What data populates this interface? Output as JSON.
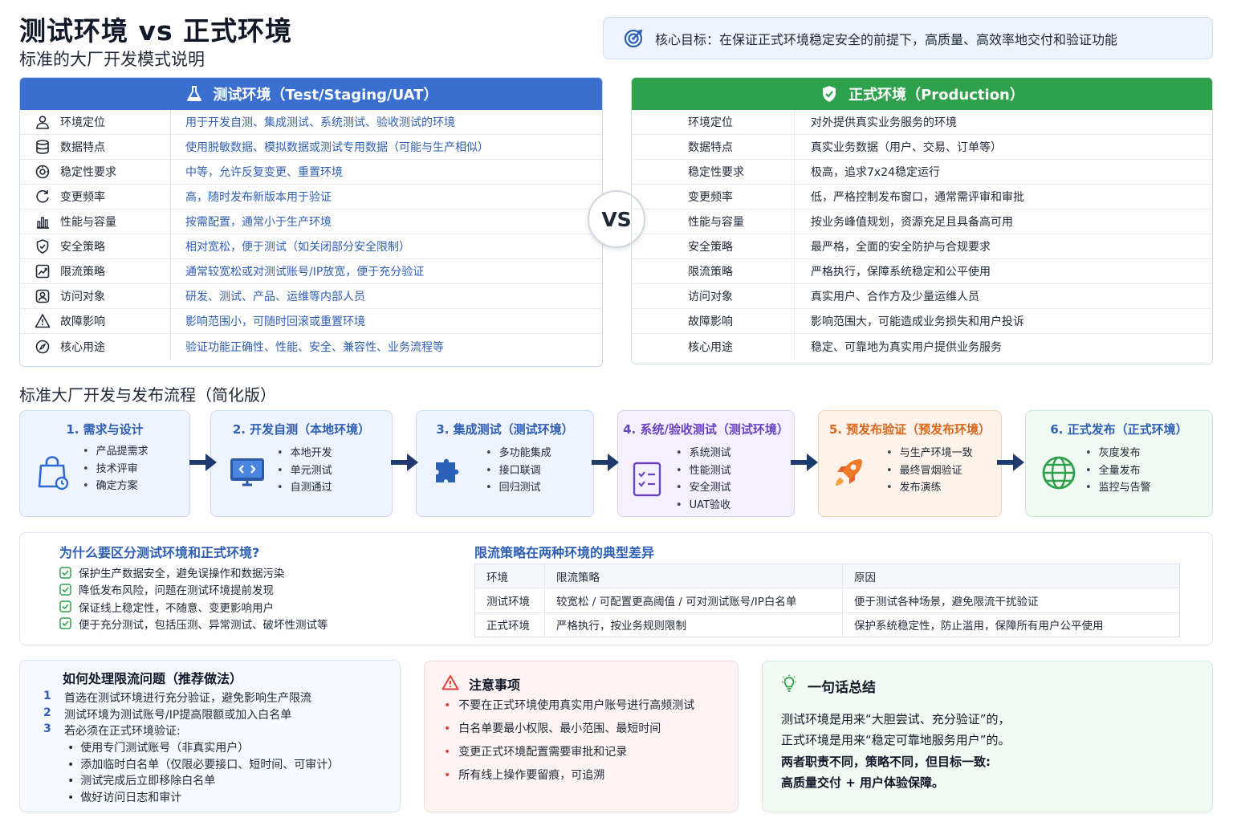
{
  "header": {
    "title": "测试环境 vs 正式环境",
    "subtitle": "标准的大厂开发模式说明",
    "goal": "核心目标：在保证正式环境稳定安全的前提下，高质量、高效率地交付和验证功能"
  },
  "test_env": {
    "title": "测试环境（Test/Staging/UAT）",
    "accent": "#3a6fd0",
    "rows": [
      {
        "label": "环境定位",
        "value": "用于开发自测、集成测试、系统测试、验收测试的环境"
      },
      {
        "label": "数据特点",
        "value": "使用脱敏数据、模拟数据或测试专用数据（可能与生产相似）"
      },
      {
        "label": "稳定性要求",
        "value": "中等，允许反复变更、重置环境"
      },
      {
        "label": "变更频率",
        "value": "高，随时发布新版本用于验证"
      },
      {
        "label": "性能与容量",
        "value": "按需配置，通常小于生产环境"
      },
      {
        "label": "安全策略",
        "value": "相对宽松，便于测试（如关闭部分安全限制）"
      },
      {
        "label": "限流策略",
        "value": "通常较宽松或对测试账号/IP放宽，便于充分验证"
      },
      {
        "label": "访问对象",
        "value": "研发、测试、产品、运维等内部人员"
      },
      {
        "label": "故障影响",
        "value": "影响范围小，可随时回滚或重置环境"
      },
      {
        "label": "核心用途",
        "value": "验证功能正确性、性能、安全、兼容性、业务流程等"
      }
    ]
  },
  "vs_label": "VS",
  "prod_env": {
    "title": "正式环境（Production）",
    "accent": "#2fa04b",
    "rows": [
      {
        "label": "环境定位",
        "value": "对外提供真实业务服务的环境"
      },
      {
        "label": "数据特点",
        "value": "真实业务数据（用户、交易、订单等）"
      },
      {
        "label": "稳定性要求",
        "value": "极高，追求7x24稳定运行"
      },
      {
        "label": "变更频率",
        "value": "低，严格控制发布窗口，通常需评审和审批"
      },
      {
        "label": "性能与容量",
        "value": "按业务峰值规划，资源充足且具备高可用"
      },
      {
        "label": "安全策略",
        "value": "最严格，全面的安全防护与合规要求"
      },
      {
        "label": "限流策略",
        "value": "严格执行，保障系统稳定和公平使用"
      },
      {
        "label": "访问对象",
        "value": "真实用户、合作方及少量运维人员"
      },
      {
        "label": "故障影响",
        "value": "影响范围大，可能造成业务损失和用户投诉"
      },
      {
        "label": "核心用途",
        "value": "稳定、可靠地为真实用户提供业务服务"
      }
    ]
  },
  "flow": {
    "title": "标准大厂开发与发布流程（简化版）",
    "steps": [
      {
        "title": "1. 需求与设计",
        "items": [
          "产品提需求",
          "技术评审",
          "确定方案"
        ],
        "color": "#2f5fb3"
      },
      {
        "title": "2. 开发自测（本地环境）",
        "items": [
          "本地开发",
          "单元测试",
          "自测通过"
        ],
        "color": "#2f5fb3"
      },
      {
        "title": "3. 集成测试（测试环境）",
        "items": [
          "多功能集成",
          "接口联调",
          "回归测试"
        ],
        "color": "#2f5fb3"
      },
      {
        "title": "4. 系统/验收测试（测试环境）",
        "items": [
          "系统测试",
          "性能测试",
          "安全测试",
          "UAT验收"
        ],
        "color": "#6a43c2"
      },
      {
        "title": "5. 预发布验证（预发布环境）",
        "items": [
          "与生产环境一致",
          "最终冒烟验证",
          "发布演练"
        ],
        "color": "#d9661a"
      },
      {
        "title": "6. 正式发布（正式环境）",
        "items": [
          "灰度发布",
          "全量发布",
          "监控与告警"
        ],
        "color": "#2f5fb3"
      }
    ]
  },
  "why": {
    "title": "为什么要区分测试环境和正式环境?",
    "items": [
      "保护生产数据安全，避免误操作和数据污染",
      "降低发布风险，问题在测试环境提前发现",
      "保证线上稳定性，不随意、变更影响用户",
      "便于充分测试，包括压测、异常测试、破坏性测试等"
    ]
  },
  "limit_table": {
    "title": "限流策略在两种环境的典型差异",
    "headers": [
      "环境",
      "限流策略",
      "原因"
    ],
    "rows": [
      [
        "测试环境",
        "较宽松 / 可配置更高阈值 / 可对测试账号/IP白名单",
        "便于测试各种场景，避免限流干扰验证"
      ],
      [
        "正式环境",
        "严格执行，按业务规则限制",
        "保护系统稳定性，防止滥用，保障所有用户公平使用"
      ]
    ]
  },
  "handle": {
    "title": "如何处理限流问题（推荐做法）",
    "numbered": [
      {
        "n": "1",
        "text": "首选在测试环境进行充分验证，避免影响生产限流"
      },
      {
        "n": "2",
        "text": "测试环境为测试账号/IP提高限额或加入白名单"
      },
      {
        "n": "3",
        "text": "若必须在正式环境验证:"
      }
    ],
    "sub_items": [
      "使用专门测试账号（非真实用户）",
      "添加临时白名单（仅限必要接口、短时间、可审计）",
      "测试完成后立即移除白名单",
      "做好访问日志和审计"
    ]
  },
  "notes": {
    "title": "注意事项",
    "items": [
      "不要在正式环境使用真实用户账号进行高频测试",
      "白名单要最小权限、最小范围、最短时间",
      "变更正式环境配置需要审批和记录",
      "所有线上操作要留痕，可追溯"
    ]
  },
  "summary": {
    "title": "一句话总结",
    "lines": [
      "测试环境是用来“大胆尝试、充分验证”的，",
      "正式环境是用来“稳定可靠地服务用户”的。",
      "两者职责不同，策略不同，但目标一致:",
      "高质量交付 + 用户体验保障。"
    ]
  }
}
